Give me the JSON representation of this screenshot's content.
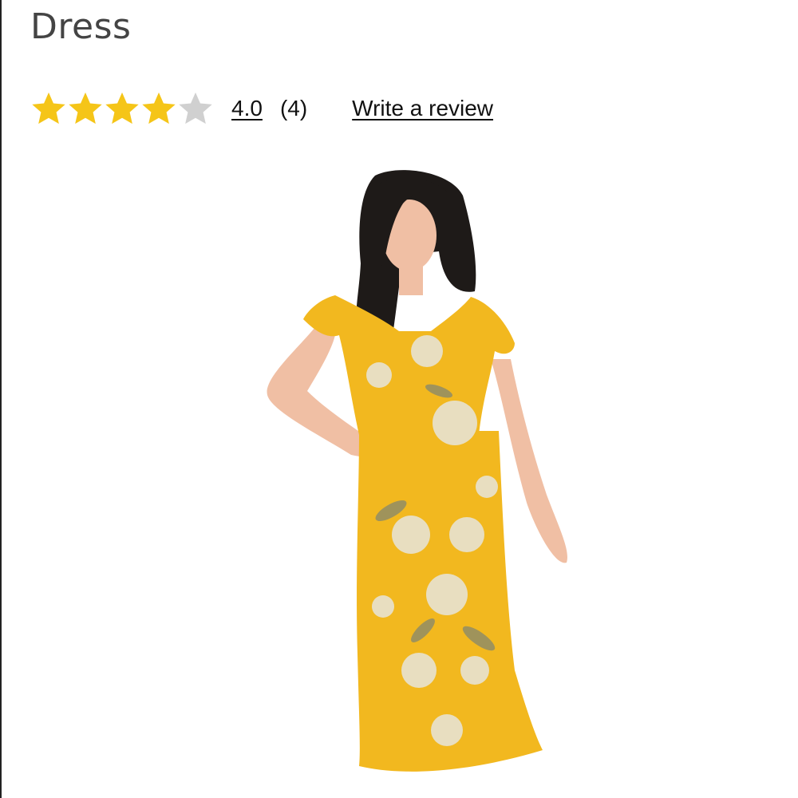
{
  "product": {
    "title": "Dress"
  },
  "rating": {
    "value": "4.0",
    "stars_filled": 4,
    "stars_total": 5,
    "review_count": "(4)",
    "write_review_label": "Write a review",
    "star_color": "#f5c518",
    "star_empty_color": "#d0d0d0"
  },
  "image": {
    "dress_color": "#f2b81f",
    "floral_color": "#e7e2d2",
    "hair_color": "#1e1a18",
    "skin_color": "#f0bfa4"
  }
}
